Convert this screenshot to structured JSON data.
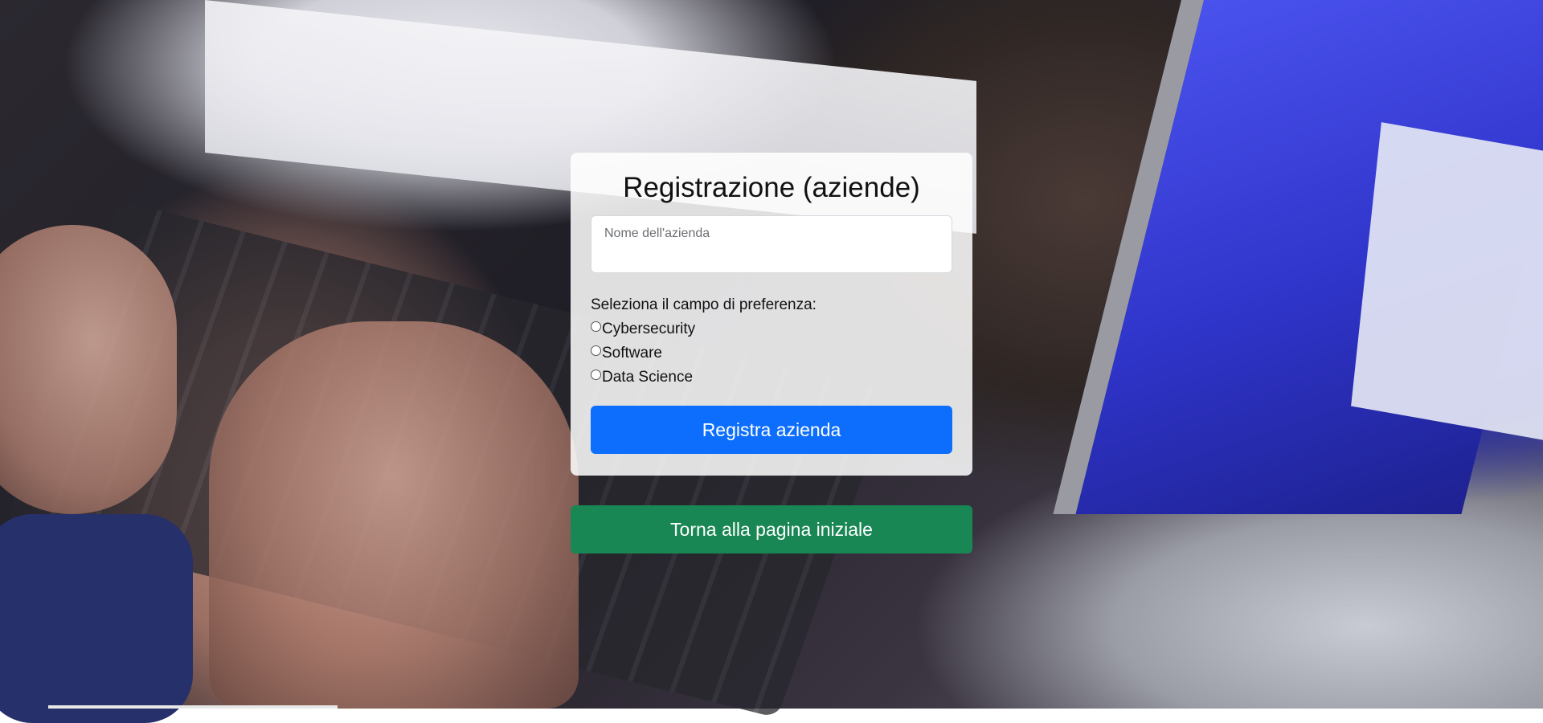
{
  "form": {
    "title": "Registrazione (aziende)",
    "company_name_label": "Nome dell'azienda",
    "company_name_value": "",
    "preference_prompt": "Seleziona il campo di preferenza:",
    "options": [
      {
        "label": "Cybersecurity",
        "selected": false
      },
      {
        "label": "Software",
        "selected": false
      },
      {
        "label": "Data Science",
        "selected": false
      }
    ],
    "submit_label": "Registra azienda"
  },
  "back_button_label": "Torna alla pagina iniziale",
  "colors": {
    "primary": "#0d6efd",
    "success": "#198754"
  },
  "background": {
    "description_icon": "laptop-typing-photo"
  }
}
